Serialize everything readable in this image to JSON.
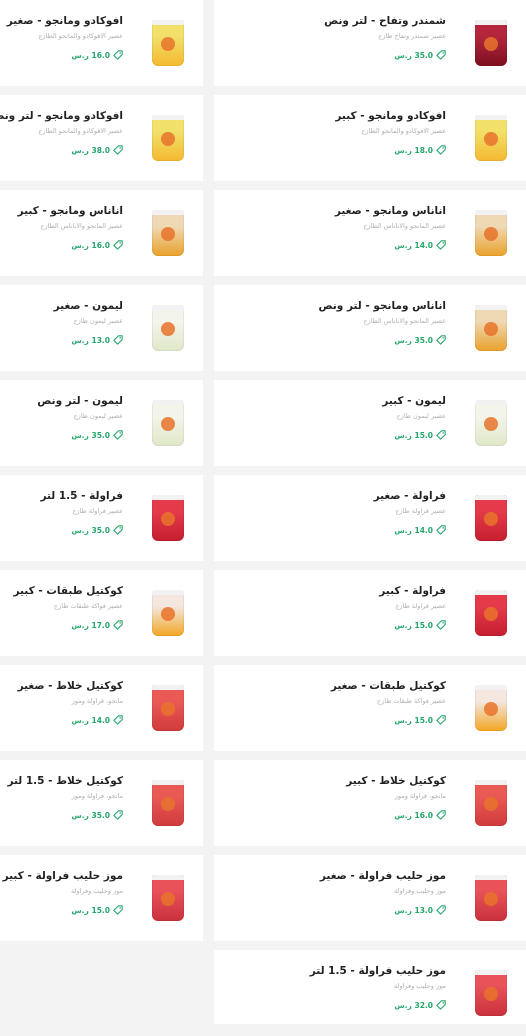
{
  "currency": "ر.س",
  "products": [
    {
      "title": "شمندر وتفاح - لتر ونص",
      "desc": "عصير شمندر وتفاح طازج",
      "price": "35.0",
      "cup": "beet"
    },
    {
      "title": "افوكادو ومانجو - صغير",
      "desc": "عصير الافوكادو والمانجو الطازج",
      "price": "16.0",
      "cup": "avocado"
    },
    {
      "title": "افوكادو ومانجو - كبير",
      "desc": "عصير الافوكادو والمانجو الطازج",
      "price": "18.0",
      "cup": "avocado"
    },
    {
      "title": "افوكادو ومانجو - لتر ونص",
      "desc": "عصير الافوكادو والمانجو الطازج",
      "price": "38.0",
      "cup": "avocado"
    },
    {
      "title": "اناناس ومانجو - صغير",
      "desc": "عصير المانجو والاناناس الطازج",
      "price": "14.0",
      "cup": "pineapple"
    },
    {
      "title": "اناناس ومانجو - كبير",
      "desc": "عصير المانجو والاناناس الطازج",
      "price": "16.0",
      "cup": "pineapple"
    },
    {
      "title": "اناناس ومانجو - لتر ونص",
      "desc": "عصير المانجو والاناناس الطازج",
      "price": "35.0",
      "cup": "pineapple"
    },
    {
      "title": "ليمون - صغير",
      "desc": "عصير ليمون طازج",
      "price": "13.0",
      "cup": "lemon"
    },
    {
      "title": "ليمون - كبير",
      "desc": "عصير ليمون طازج",
      "price": "15.0",
      "cup": "lemon"
    },
    {
      "title": "ليمون - لتر ونص",
      "desc": "عصير ليمون طازج",
      "price": "35.0",
      "cup": "lemon"
    },
    {
      "title": "فراولة - صغير",
      "desc": "عصير فراولة طازج",
      "price": "14.0",
      "cup": "strawberry"
    },
    {
      "title": "فراولة - 1.5 لتر",
      "desc": "عصير فراولة طازج",
      "price": "35.0",
      "cup": "strawberry"
    },
    {
      "title": "فراولة - كبير",
      "desc": "عصير فراولة طازج",
      "price": "15.0",
      "cup": "strawberry"
    },
    {
      "title": "كوكتيل طبقات - كبير",
      "desc": "عصير فواكة طبقات طازج",
      "price": "17.0",
      "cup": "layers"
    },
    {
      "title": "كوكتيل طبقات - صغير",
      "desc": "عصير فواكة طبقات طازج",
      "price": "15.0",
      "cup": "layers"
    },
    {
      "title": "كوكتيل خلاط - صغير",
      "desc": "مانجو، فراولة وموز",
      "price": "14.0",
      "cup": "mix"
    },
    {
      "title": "كوكتيل خلاط - كبير",
      "desc": "مانجو، فراولة وموز",
      "price": "16.0",
      "cup": "mix"
    },
    {
      "title": "كوكتيل خلاط - 1.5 لتر",
      "desc": "مانجو، فراولة وموز",
      "price": "35.0",
      "cup": "mix"
    },
    {
      "title": "موز حليب فراولة - صغير",
      "desc": "موز وحليب وفراولة",
      "price": "13.0",
      "cup": "milk"
    },
    {
      "title": "موز حليب فراولة - كبير",
      "desc": "موز وحليب وفراولة",
      "price": "15.0",
      "cup": "milk"
    },
    {
      "title": "موز حليب فراولة - 1.5 لتر",
      "desc": "موز وحليب وفراولة",
      "price": "32.0",
      "cup": "milk"
    }
  ],
  "cup_colors": {
    "beet": [
      "#b3263c",
      "#7c1020"
    ],
    "avocado": [
      "#f1e06a",
      "#f4b930"
    ],
    "pineapple": [
      "#efd9b5",
      "#e9a12a"
    ],
    "lemon": [
      "#f3f5ea",
      "#dfe8c9"
    ],
    "strawberry": [
      "#e53a4a",
      "#c41f30"
    ],
    "layers": [
      "#f3e7e0",
      "#f2a623"
    ],
    "mix": [
      "#ea5a55",
      "#d03a3c"
    ],
    "milk": [
      "#e95258",
      "#c9313d"
    ]
  },
  "accent_green": "#23a66b"
}
